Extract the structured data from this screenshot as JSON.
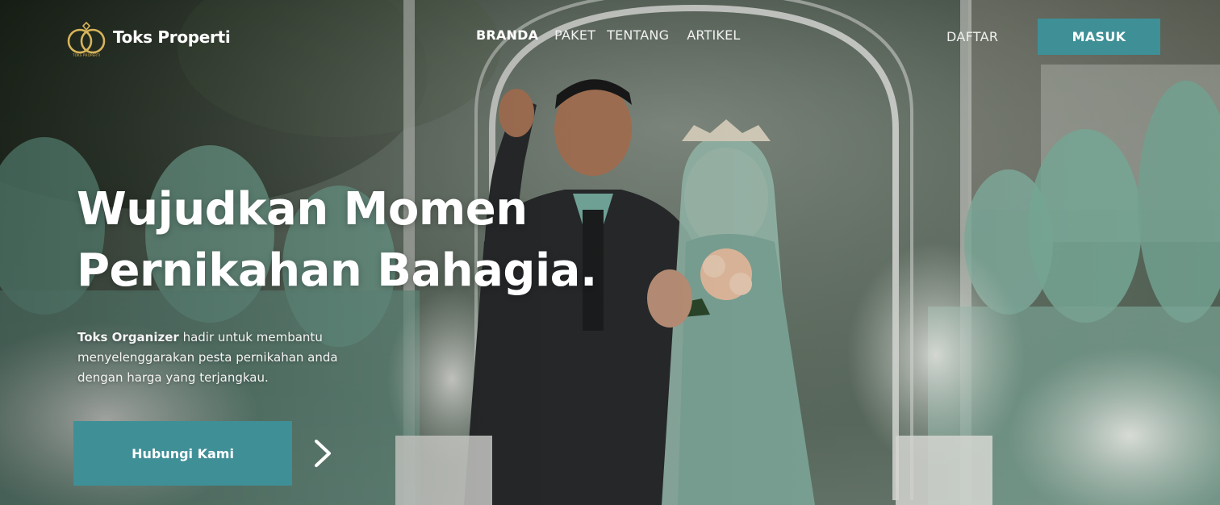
{
  "brand": {
    "name": "Toks Properti",
    "logo_tagline": "TOKS PROPERTI",
    "gold": "#d7b45a"
  },
  "nav": {
    "items": [
      {
        "label": "BRANDA",
        "active": true
      },
      {
        "label": "PAKET",
        "active": false
      },
      {
        "label": "TENTANG",
        "active": false
      },
      {
        "label": "ARTIKEL",
        "active": false
      }
    ],
    "register_label": "DAFTAR",
    "login_label": "MASUK"
  },
  "hero": {
    "headline_line1": "Wujudkan Momen",
    "headline_line2": "Pernikahan Bahagia.",
    "description_bold": "Toks Organizer",
    "description_rest": " hadir untuk membantu menyelenggarakan pesta pernikahan anda dengan harga yang terjangkau.",
    "cta_label": "Hubungi Kami",
    "next_icon": "chevron-right-icon"
  },
  "colors": {
    "accent": "#3f8f97",
    "text": "#ffffff"
  }
}
